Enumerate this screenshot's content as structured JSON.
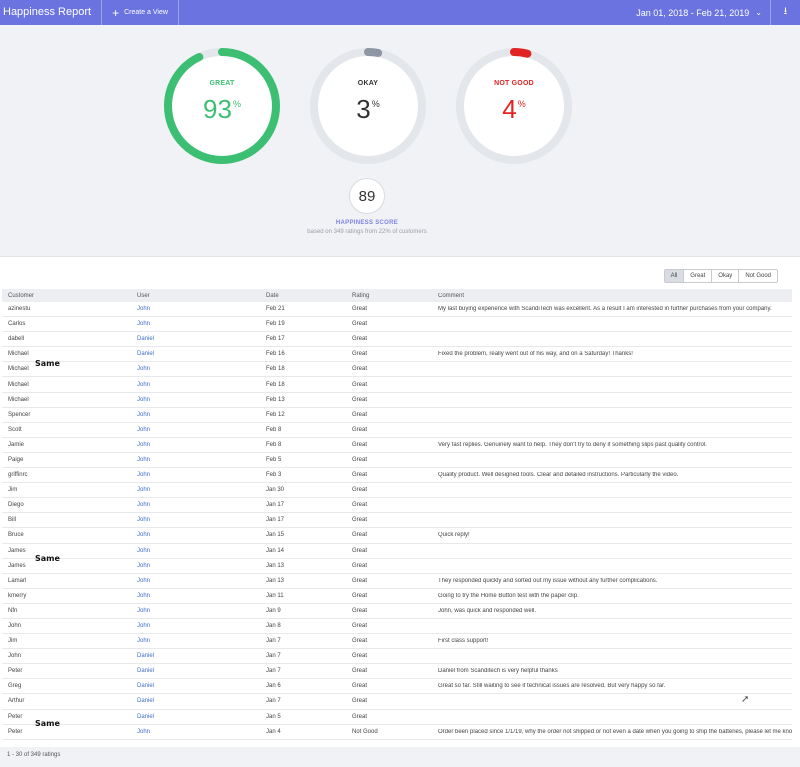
{
  "header": {
    "title": "Happiness Report",
    "create_view": "Create a View",
    "date_range": "Jan 01, 2018 - Feb 21, 2019",
    "plus_icon": "+",
    "chevron_icon": "⌄",
    "download_icon": "⭳"
  },
  "gauges": [
    {
      "label": "GREAT",
      "value": "93",
      "unit": "%",
      "fraction": 0.93,
      "color": "#3cbf72"
    },
    {
      "label": "OKAY",
      "value": "3",
      "unit": "%",
      "fraction": 0.03,
      "color": "#8f96a3"
    },
    {
      "label": "NOT GOOD",
      "value": "4",
      "unit": "%",
      "fraction": 0.04,
      "color": "#e02424"
    }
  ],
  "score": {
    "value": "89",
    "label": "HAPPINESS SCORE",
    "sub": "based on 349 ratings from 22% of customers"
  },
  "filters": [
    "All",
    "Great",
    "Okay",
    "Not Good"
  ],
  "columns": [
    "Customer",
    "User",
    "Date",
    "Rating",
    "Comment"
  ],
  "rows": [
    {
      "customer": "azinestu",
      "user": "John",
      "date": "Feb 21",
      "rating": "Great",
      "comment": "My last buying experience with ScandiTech was excellent. As a result I am interested in further purchases from your company."
    },
    {
      "customer": "Carlos",
      "user": "John",
      "date": "Feb 19",
      "rating": "Great",
      "comment": ""
    },
    {
      "customer": "dabell",
      "user": "Daniel",
      "date": "Feb 17",
      "rating": "Great",
      "comment": ""
    },
    {
      "customer": "Michael",
      "user": "Daniel",
      "date": "Feb 16",
      "rating": "Great",
      "comment": "Fixed the problem, really went out of his way, and on a Saturday! Thanks!"
    },
    {
      "customer": "Michael",
      "user": "John",
      "date": "Feb 18",
      "rating": "Great",
      "comment": ""
    },
    {
      "customer": "Michael",
      "user": "John",
      "date": "Feb 18",
      "rating": "Great",
      "comment": ""
    },
    {
      "customer": "Michael",
      "user": "John",
      "date": "Feb 13",
      "rating": "Great",
      "comment": ""
    },
    {
      "customer": "Spencer",
      "user": "John",
      "date": "Feb 12",
      "rating": "Great",
      "comment": ""
    },
    {
      "customer": "Scott",
      "user": "John",
      "date": "Feb 8",
      "rating": "Great",
      "comment": ""
    },
    {
      "customer": "Jamie",
      "user": "John",
      "date": "Feb 8",
      "rating": "Great",
      "comment": "Very fast replies. Genuinely want to help. They don't try to deny if something slips past quality control."
    },
    {
      "customer": "Paige",
      "user": "John",
      "date": "Feb 5",
      "rating": "Great",
      "comment": ""
    },
    {
      "customer": "griffinrc",
      "user": "John",
      "date": "Feb 3",
      "rating": "Great",
      "comment": "Quality product. Well designed tools. Clear and detailed instructions. Particularly the video."
    },
    {
      "customer": "Jim",
      "user": "John",
      "date": "Jan 30",
      "rating": "Great",
      "comment": ""
    },
    {
      "customer": "Diego",
      "user": "John",
      "date": "Jan 17",
      "rating": "Great",
      "comment": ""
    },
    {
      "customer": "Bill",
      "user": "John",
      "date": "Jan 17",
      "rating": "Great",
      "comment": ""
    },
    {
      "customer": "Bruce",
      "user": "John",
      "date": "Jan 15",
      "rating": "Great",
      "comment": "Quick reply!"
    },
    {
      "customer": "James",
      "user": "John",
      "date": "Jan 14",
      "rating": "Great",
      "comment": ""
    },
    {
      "customer": "James",
      "user": "John",
      "date": "Jan 13",
      "rating": "Great",
      "comment": ""
    },
    {
      "customer": "Lamarl",
      "user": "John",
      "date": "Jan 13",
      "rating": "Great",
      "comment": "They responded quickly and sorted out my issue without any further complications."
    },
    {
      "customer": "kmerry",
      "user": "John",
      "date": "Jan 11",
      "rating": "Great",
      "comment": "Going to try the Home Button test with the paper clip."
    },
    {
      "customer": "Nfn",
      "user": "John",
      "date": "Jan 9",
      "rating": "Great",
      "comment": "John, was quick and responded well."
    },
    {
      "customer": "John",
      "user": "John",
      "date": "Jan 8",
      "rating": "Great",
      "comment": ""
    },
    {
      "customer": "Jim",
      "user": "John",
      "date": "Jan 7",
      "rating": "Great",
      "comment": "First class support!"
    },
    {
      "customer": "John",
      "user": "Daniel",
      "date": "Jan 7",
      "rating": "Great",
      "comment": ""
    },
    {
      "customer": "Peter",
      "user": "Daniel",
      "date": "Jan 7",
      "rating": "Great",
      "comment": "Daniel from Scanditech is very helpful thanks"
    },
    {
      "customer": "Greg",
      "user": "Daniel",
      "date": "Jan 6",
      "rating": "Great",
      "comment": "Great so far. Still waiting to see if technical issues are resolved. But very happy so far."
    },
    {
      "customer": "Arthur",
      "user": "Daniel",
      "date": "Jan 7",
      "rating": "Great",
      "comment": ""
    },
    {
      "customer": "Peter",
      "user": "Daniel",
      "date": "Jan 5",
      "rating": "Great",
      "comment": ""
    },
    {
      "customer": "Peter",
      "user": "John",
      "date": "Jan 4",
      "rating": "Not Good",
      "comment": "Order been placed since 1/1/19, why the order not shipped or not even a date when you going to ship the batteries, please let me know what's the problem"
    }
  ],
  "annotations": [
    "Same",
    "Same",
    "Same"
  ],
  "footer": "1 - 30 of 349 ratings"
}
